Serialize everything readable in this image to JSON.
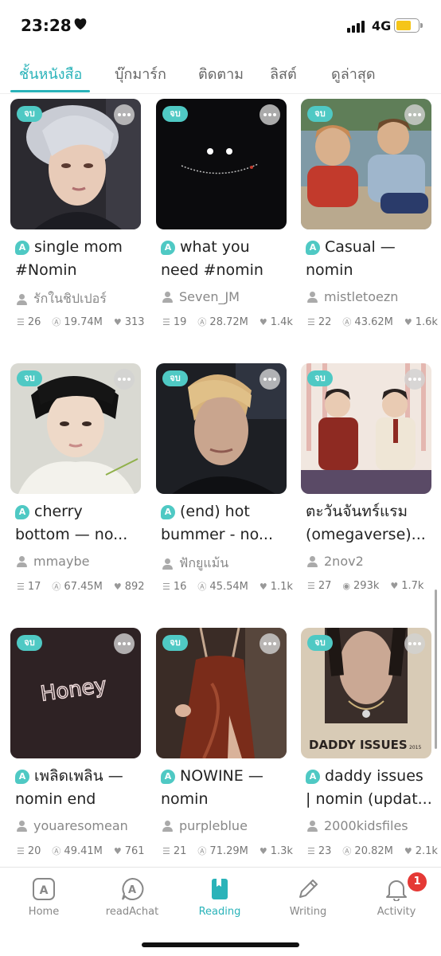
{
  "status_bar": {
    "time": "23:28",
    "network": "4G"
  },
  "tabs": [
    {
      "label": "ชั้นหนังสือ",
      "active": true
    },
    {
      "label": "บุ๊กมาร์ก",
      "active": false
    },
    {
      "label": "ติดตาม",
      "active": false
    },
    {
      "label": "ลิสต์",
      "active": false
    },
    {
      "label": "ดูล่าสุด",
      "active": false
    }
  ],
  "books": [
    {
      "badge": "จบ",
      "title": "single mom\n#Nomin",
      "author": "รักในชิปเปอร์",
      "chapters": "26",
      "views": "19.74M",
      "likes": "313",
      "views_icon": "readAwrite-icon"
    },
    {
      "badge": "จบ",
      "title": "what you\nneed #nomin",
      "author": "Seven_JM",
      "chapters": "19",
      "views": "28.72M",
      "likes": "1.4k",
      "views_icon": "readAwrite-icon"
    },
    {
      "badge": "จบ",
      "title": "Casual —\nnomin",
      "author": "mistletoezn",
      "chapters": "22",
      "views": "43.62M",
      "likes": "1.6k",
      "views_icon": "readAwrite-icon"
    },
    {
      "badge": "จบ",
      "title": "cherry\nbottom — no...",
      "author": "mmaybe",
      "chapters": "17",
      "views": "67.45M",
      "likes": "892",
      "views_icon": "readAwrite-icon"
    },
    {
      "badge": "จบ",
      "title": "(end) hot\nbummer - no...",
      "author": "ฟักยูแม้น",
      "chapters": "16",
      "views": "45.54M",
      "likes": "1.1k",
      "views_icon": "readAwrite-icon"
    },
    {
      "badge": "จบ",
      "title": "ตะวันจันทร์แรม\n(omegaverse)...",
      "author": "2nov2",
      "chapters": "27",
      "views": "293k",
      "likes": "1.7k",
      "views_icon": "eye-icon",
      "no_title_icon": true
    },
    {
      "badge": "จบ",
      "title": "เพลิดเพลิน —\nnomin end",
      "author": "youaresomean",
      "chapters": "20",
      "views": "49.41M",
      "likes": "761",
      "views_icon": "readAwrite-icon"
    },
    {
      "badge": "จบ",
      "title": "NOWINE —\nnomin",
      "author": "purpleblue",
      "chapters": "21",
      "views": "71.29M",
      "likes": "1.3k",
      "views_icon": "readAwrite-icon"
    },
    {
      "badge": "จบ",
      "title": "daddy issues\n| nomin (updat...",
      "author": "2000kidsfiles",
      "chapters": "23",
      "views": "20.82M",
      "likes": "2.1k",
      "views_icon": "readAwrite-icon"
    }
  ],
  "cover_texts": {
    "honey": "Honey",
    "daddy": "DADDY ISSUES",
    "daddy_year": "2015"
  },
  "bottom_nav": [
    {
      "label": "Home",
      "icon": "home-a-icon",
      "active": false
    },
    {
      "label": "readAchat",
      "icon": "chat-a-icon",
      "active": false
    },
    {
      "label": "Reading",
      "icon": "book-icon",
      "active": true
    },
    {
      "label": "Writing",
      "icon": "pencil-icon",
      "active": false
    },
    {
      "label": "Activity",
      "icon": "bell-icon",
      "active": false
    }
  ],
  "activity_badge": "1",
  "colors": {
    "accent": "#2ab3b9",
    "badge": "#4fc9c4",
    "notification": "#e53935"
  }
}
